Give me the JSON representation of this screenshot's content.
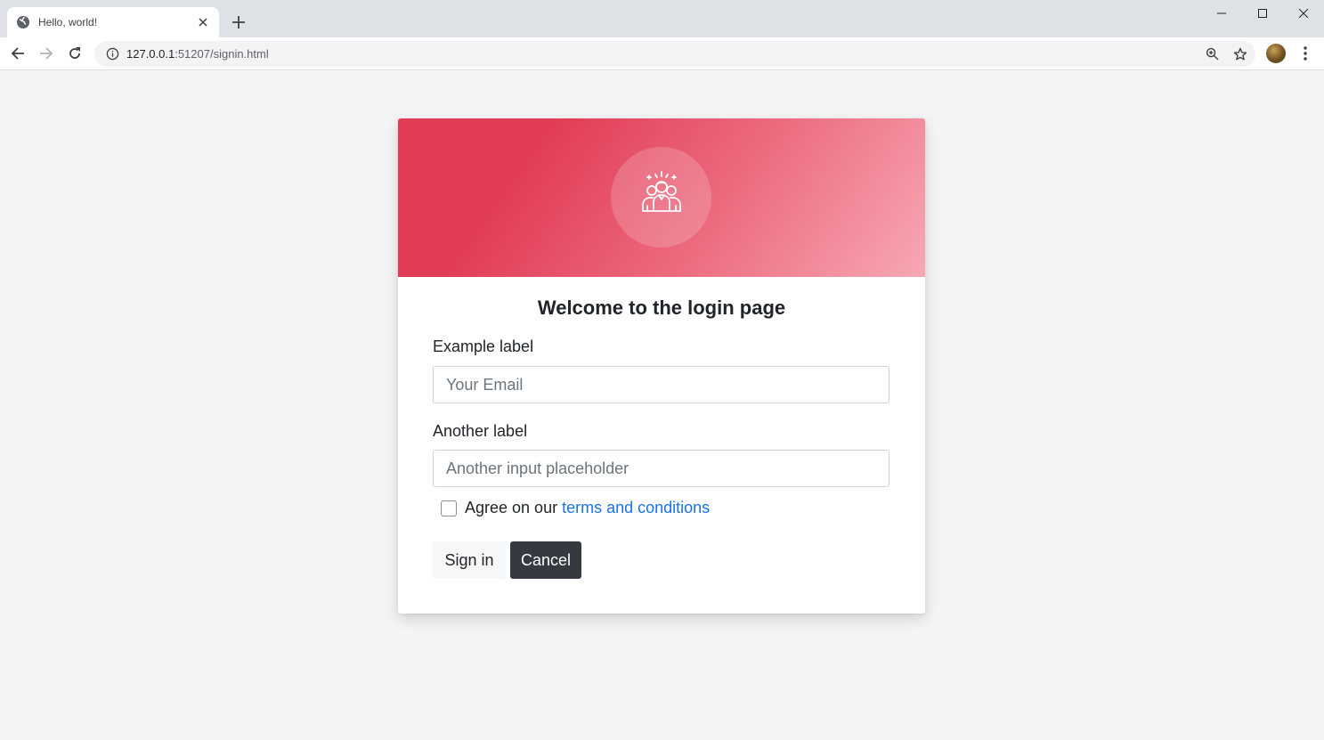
{
  "browser": {
    "tab_title": "Hello, world!",
    "url_host": "127.0.0.1",
    "url_rest": ":51207/signin.html"
  },
  "icons": {
    "favicon": "globe-icon",
    "tab_close": "close-icon",
    "new_tab": "plus-icon",
    "back": "arrow-left-icon",
    "forward": "arrow-right-icon",
    "reload": "reload-icon",
    "site_info": "info-icon",
    "zoom": "zoom-icon",
    "bookmark": "star-icon",
    "menu": "kebab-menu-icon",
    "header_graphic": "team-icon"
  },
  "colors": {
    "header_gradient_start": "#e23d58",
    "header_gradient_end": "#f7a8b4",
    "link": "#1a73e8",
    "cancel_bg": "#343a40"
  },
  "login": {
    "title": "Welcome to the login page",
    "email_label": "Example label",
    "email_placeholder": "Your Email",
    "email_value": "",
    "second_label": "Another label",
    "second_placeholder": "Another input placeholder",
    "second_value": "",
    "agree_text": "Agree on our",
    "terms_link": "terms and conditions",
    "agree_checked": false,
    "signin_label": "Sign in",
    "cancel_label": "Cancel"
  }
}
